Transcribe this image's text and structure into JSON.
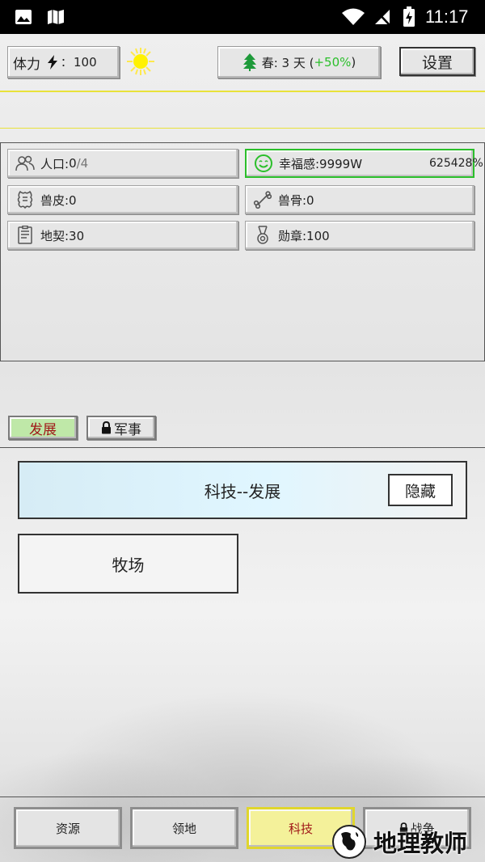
{
  "status_bar": {
    "time": "11:17"
  },
  "top_bar": {
    "stamina_label": "体力",
    "stamina_sep": "：",
    "stamina_value": "100",
    "season": "春: 3 天 (",
    "season_bonus": "+50%",
    "season_close": ")",
    "settings_label": "设置"
  },
  "resources": {
    "population_label": "人口:",
    "population_value": "0",
    "population_max": "/4",
    "happiness": "幸福感:9999W",
    "happiness_pct": "625428%",
    "hide": "兽皮:0",
    "bone": "兽骨:0",
    "deed": "地契:30",
    "medal": "勋章:100"
  },
  "tabs": {
    "development": "发展",
    "military": "军事"
  },
  "tech_panel": {
    "title": "科技--发展",
    "hide_button": "隐藏",
    "items": [
      "牧场"
    ]
  },
  "bottom_nav": [
    {
      "label": "资源"
    },
    {
      "label": "领地"
    },
    {
      "label": "科技"
    },
    {
      "label": "战争"
    }
  ],
  "watermark": {
    "text": "地理教师"
  },
  "colors": {
    "accent_green": "#2bbf2b",
    "highlight_yellow": "#e8e23a",
    "tab_text_red": "#a01818"
  }
}
